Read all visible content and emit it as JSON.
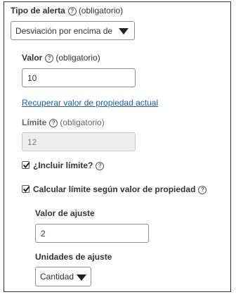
{
  "alert_type": {
    "label": "Tipo de alerta",
    "required": "(obligatorio)",
    "selected": "Desviación por encima de"
  },
  "valor": {
    "label": "Valor",
    "required": "(obligatorio)",
    "value": "10"
  },
  "recover_link": "Recuperar valor de propiedad actual",
  "limite": {
    "label": "Límite",
    "required": "(obligatorio)",
    "value": "12"
  },
  "include_limit": {
    "label": "¿Incluir límite?",
    "checked": true
  },
  "calc_limit": {
    "label": "Calcular límite según valor de propiedad",
    "checked": true
  },
  "adjust_value": {
    "label": "Valor de ajuste",
    "value": "2"
  },
  "adjust_units": {
    "label": "Unidades de ajuste",
    "selected": "Cantidad"
  },
  "icons": {
    "help": "?",
    "caret": "chevron-down-icon",
    "check": "checkmark-icon"
  },
  "colors": {
    "link": "#1a5fa8",
    "disabled_bg": "#eeeeee"
  }
}
